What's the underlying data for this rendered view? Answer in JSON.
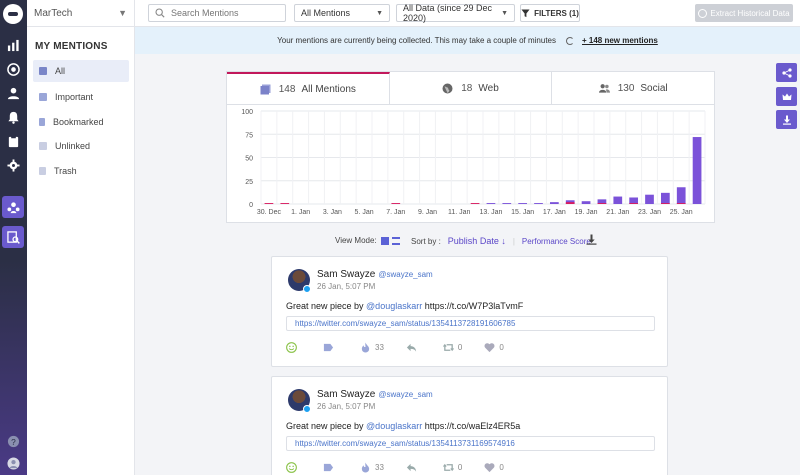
{
  "project": {
    "name": "MarTech"
  },
  "sidebar": {
    "title": "MY MENTIONS",
    "items": [
      {
        "label": "All",
        "color": "#7a86c8"
      },
      {
        "label": "Important",
        "color": "#9aa6d8"
      },
      {
        "label": "Bookmarked",
        "color": "#9aa6d8"
      },
      {
        "label": "Unlinked",
        "color": "#c9cee2"
      },
      {
        "label": "Trash",
        "color": "#c9cee2"
      }
    ]
  },
  "rail": {
    "icons": [
      "logo-icon",
      "bar-chart-icon",
      "target-icon",
      "user-icon",
      "bell-icon",
      "clipboard-icon",
      "gear-icon",
      "users-icon",
      "search-doc-icon",
      "help-icon",
      "account-icon"
    ]
  },
  "topbar": {
    "search_placeholder": "Search Mentions",
    "mentions_filter": "All Mentions",
    "date_filter": "All Data (since 29 Dec 2020)",
    "filters_label": "FILTERS (1)",
    "extract_label": "Extract Historical Data"
  },
  "infobar": {
    "message": "Your mentions are currently being collected. This may take a couple of minutes",
    "new_link": "+ 148 new mentions"
  },
  "tabs": [
    {
      "count": "148",
      "label": "All Mentions"
    },
    {
      "count": "18",
      "label": "Web"
    },
    {
      "count": "130",
      "label": "Social"
    }
  ],
  "chart_data": {
    "type": "bar",
    "categories": [
      "30. Dec",
      "31. Dec",
      "1. Jan",
      "2. Jan",
      "3. Jan",
      "4. Jan",
      "5. Jan",
      "6. Jan",
      "7. Jan",
      "8. Jan",
      "9. Jan",
      "10. Jan",
      "11. Jan",
      "12. Jan",
      "13. Jan",
      "14. Jan",
      "15. Jan",
      "16. Jan",
      "17. Jan",
      "18. Jan",
      "19. Jan",
      "20. Jan",
      "21. Jan",
      "22. Jan",
      "23. Jan",
      "24. Jan",
      "25. Jan",
      "26. Jan"
    ],
    "tick_labels": [
      "30. Dec",
      "1. Jan",
      "3. Jan",
      "5. Jan",
      "7. Jan",
      "9. Jan",
      "11. Jan",
      "13. Jan",
      "15. Jan",
      "17. Jan",
      "19. Jan",
      "21. Jan",
      "23. Jan",
      "25. Jan"
    ],
    "series": [
      {
        "color": "#7b52d9",
        "values": [
          0,
          0,
          0,
          0,
          0,
          0,
          0,
          0,
          0,
          0,
          0,
          0,
          0,
          0,
          1,
          1,
          1,
          1,
          2,
          4,
          3,
          5,
          8,
          7,
          10,
          12,
          18,
          72
        ]
      },
      {
        "color": "#d81b60",
        "values": [
          1,
          1,
          0,
          0,
          0,
          0,
          0,
          0,
          1,
          0,
          0,
          0,
          0,
          1,
          0,
          0,
          0,
          0,
          0,
          2,
          0,
          1,
          0,
          1,
          0,
          1,
          1,
          0
        ]
      }
    ],
    "yticks": [
      0,
      25,
      50,
      75,
      100
    ],
    "ylim": [
      0,
      100
    ],
    "grid": true
  },
  "controls": {
    "view_mode_label": "View Mode:",
    "sort_label": "Sort by :",
    "sort_publish": "Publish Date ↓",
    "sort_performance": "Performance Score"
  },
  "posts": [
    {
      "name": "Sam Swayze",
      "handle": "@swayze_sam",
      "time": "26 Jan, 5:07 PM",
      "text_before": "Great new piece by ",
      "mention": "@douglaskarr",
      "text_after": " https://t.co/W7P3laTvmF",
      "url": "https://twitter.com/swayze_sam/status/1354113728191606785",
      "reach": "33",
      "retweets": "0",
      "likes": "0"
    },
    {
      "name": "Sam Swayze",
      "handle": "@swayze_sam",
      "time": "26 Jan, 5:07 PM",
      "text_before": "Great new piece by ",
      "mention": "@douglaskarr",
      "text_after": " https://t.co/waElz4ER5a",
      "url": "https://twitter.com/swayze_sam/status/1354113731169574916",
      "reach": "33",
      "retweets": "0",
      "likes": "0"
    }
  ]
}
